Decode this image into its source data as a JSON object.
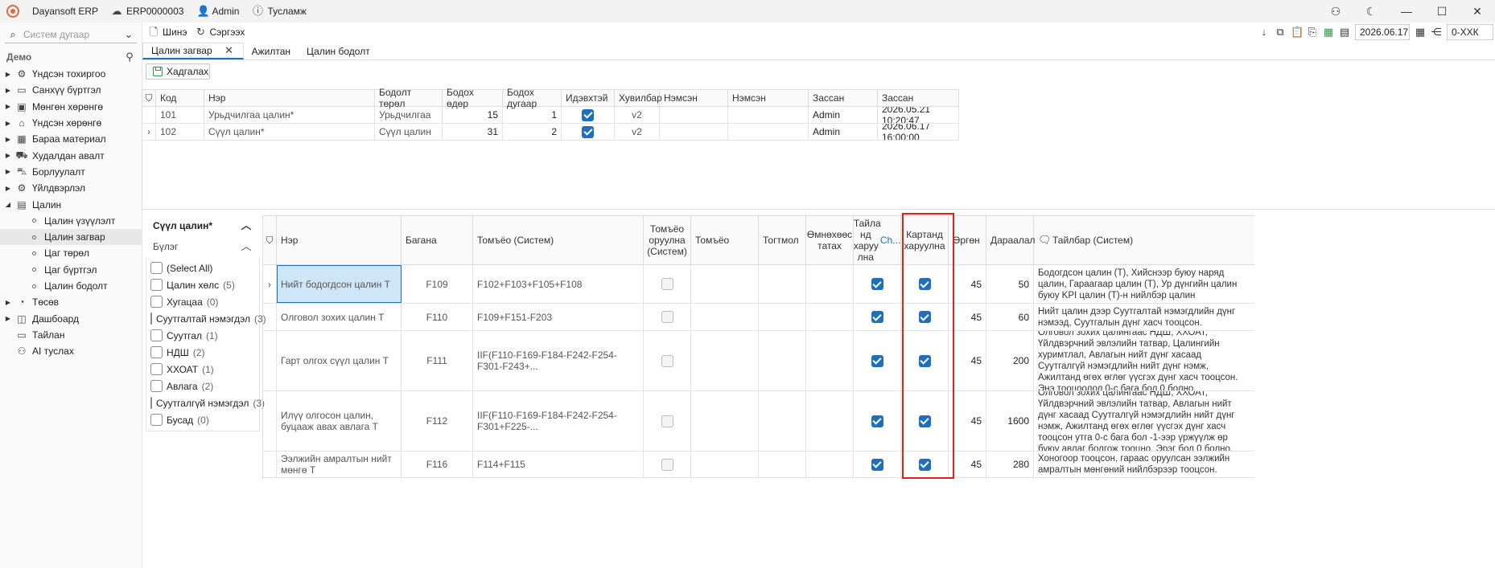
{
  "titlebar": {
    "app_name": "Dayansoft ERP",
    "company": "ERP0000003",
    "user": "Admin",
    "help": "Тусламж"
  },
  "sidebar": {
    "search_placeholder": "Систем дугаар",
    "section": "Демо",
    "items": [
      {
        "label": "Үндсэн тохиргоо",
        "icon": "gear-icon"
      },
      {
        "label": "Санхүү бүртгэл",
        "icon": "ledger-icon"
      },
      {
        "label": "Мөнгөн хөрөнгө",
        "icon": "money-icon"
      },
      {
        "label": "Үндсэн хөрөнгө",
        "icon": "asset-icon"
      },
      {
        "label": "Бараа материал",
        "icon": "box-icon"
      },
      {
        "label": "Худалдан авалт",
        "icon": "truck-icon"
      },
      {
        "label": "Борлуулалт",
        "icon": "cart-icon"
      },
      {
        "label": "Үйлдвэрлэл",
        "icon": "factory-icon"
      },
      {
        "label": "Цалин",
        "icon": "calculator-icon"
      }
    ],
    "salary_children": [
      "Цалин үзүүлэлт",
      "Цалин загвар",
      "Цаг төрөл",
      "Цаг бүртгэл",
      "Цалин бодолт"
    ],
    "bottom_items": [
      {
        "label": "Төсөв",
        "icon": "pie-icon"
      },
      {
        "label": "Дашбоард",
        "icon": "dashboard-icon"
      },
      {
        "label": "Тайлан",
        "icon": "report-icon"
      },
      {
        "label": "AI туслах",
        "icon": "ai-icon"
      }
    ]
  },
  "toolbar": {
    "new_label": "Шинэ",
    "refresh_label": "Сэргээх",
    "date": "2026.06.17",
    "branch": "0-ХХК"
  },
  "tabs": [
    {
      "label": "Цалин загвар",
      "active": true
    },
    {
      "label": "Ажилтан"
    },
    {
      "label": "Цалин бодолт"
    }
  ],
  "save_label": "Хадгалах",
  "top_grid": {
    "headers": [
      "Код",
      "Нэр",
      "Бодолт төрөл",
      "Бодох өдөр",
      "Бодох дугаар",
      "Идэвхтэй",
      "Хувилбар",
      "Нэмсэн",
      "Нэмсэн",
      "Зассан",
      "Зассан"
    ],
    "rows": [
      {
        "code": "101",
        "name": "Урьдчилгаа цалин*",
        "type": "Урьдчилгаа",
        "day": "15",
        "number": "1",
        "active": true,
        "version": "v2",
        "added_by": "",
        "added_at": "",
        "edited_by": "Admin",
        "edited_at": "2026.05.21 10:20:47"
      },
      {
        "code": "102",
        "name": "Сүүл цалин*",
        "type": "Сүүл цалин",
        "day": "31",
        "number": "2",
        "active": true,
        "version": "v2",
        "added_by": "",
        "added_at": "",
        "edited_by": "Admin",
        "edited_at": "2026.06.17 16:00:00"
      }
    ]
  },
  "filter_panel": {
    "title": "Сүүл цалин*",
    "group_label": "Бүлэг",
    "items": [
      {
        "label": "(Select All)",
        "count": ""
      },
      {
        "label": "Цалин хөлс",
        "count": "(5)"
      },
      {
        "label": "Хугацаа",
        "count": "(0)"
      },
      {
        "label": "Суутгалтай нэмэгдэл",
        "count": "(3)"
      },
      {
        "label": "Суутгал",
        "count": "(1)"
      },
      {
        "label": "НДШ",
        "count": "(2)"
      },
      {
        "label": "ХХОАТ",
        "count": "(1)"
      },
      {
        "label": "Авлага",
        "count": "(2)"
      },
      {
        "label": "Суутгалгүй нэмэгдэл",
        "count": "(3)"
      },
      {
        "label": "Бусад",
        "count": "(0)"
      }
    ]
  },
  "detail_grid": {
    "headers": {
      "name": "Нэр",
      "column": "Багана",
      "formula_system": "Томъёо (Систем)",
      "formula_insert": "Томъёо оруулна (Систем)",
      "formula": "Томъёо",
      "constant": "Тогтмол",
      "pull_prev": "Өмнөхөөс татах",
      "show_report": "Тайла нд харуу лна",
      "show_report_extra": "Ch...",
      "show_card": "Картанд харуулна",
      "width": "Өргөн",
      "order": "Дараалал",
      "note": "Тайлбар (Систем)"
    },
    "rows": [
      {
        "name": "Нийт бодогдсон цалин Т",
        "column": "F109",
        "formula_system": "F102+F103+F105+F108",
        "report": true,
        "card": true,
        "width": "45",
        "order": "50",
        "note": "Бодогдсон цалин (Т), Хийснээр буюу наряд цалин, Гараагаар цалин (Т), Ур дүнгийн цалин буюу KPI цалин (Т)-н нийлбэр цалин"
      },
      {
        "name": "Олговол зохих цалин Т",
        "column": "F110",
        "formula_system": "F109+F151-F203",
        "report": true,
        "card": true,
        "width": "45",
        "order": "60",
        "note": "Нийт цалин дээр Суутгалтай нэмэгдлийн дүнг нэмээд, Суутгалын дүнг хасч тооцсон."
      },
      {
        "name": "Гарт олгох сүүл цалин Т",
        "column": "F111",
        "formula_system": "IIF(F110-F169-F184-F242-F254-F301-F243+...",
        "report": true,
        "card": true,
        "width": "45",
        "order": "200",
        "note": "Олговол зохих цалингаас НДШ, ХХОАТ, Үйлдвэрчний эвлэлийн татвар, Цалингийн хуримтлал, Авлагын нийт дүнг хасаад Суутгалгүй нэмэгдлийн нийт дүнг нэмж, Ажилтанд өгөх өглөг үүсгэх дүнг хасч тооцсон. Энэ тооцоолол 0-с бага бол 0 болно."
      },
      {
        "name": "Илүү олгосон цалин, буцааж авах авлага Т",
        "column": "F112",
        "formula_system": "IIF(F110-F169-F184-F242-F254-F301+F225-...",
        "report": true,
        "card": true,
        "width": "45",
        "order": "1600",
        "note": "Олговол зохих цалингаас НДШ, ХХОАТ, Үйлдвэрчний эвлэлийн татвар, Авлагын нийт дүнг хасаад Суутгалгүй нэмэгдлийн нийт дүнг нэмж, Ажилтанд өгөх өглөг үүсгэх дүнг хасч тооцсон утга 0-с бага бол -1-ээр үржүүлж өр буюу авлаг болгож тооцно. Эрэг бол 0 болно."
      },
      {
        "name": "Ээлжийн амралтын нийт мөнгө Т",
        "column": "F116",
        "formula_system": "F114+F115",
        "report": true,
        "card": true,
        "width": "45",
        "order": "280",
        "note": "Хоногоор тооцсон, гараас оруулсан ээлжийн амралтын мөнгөний нийлбэрээр тооцсон."
      }
    ]
  }
}
